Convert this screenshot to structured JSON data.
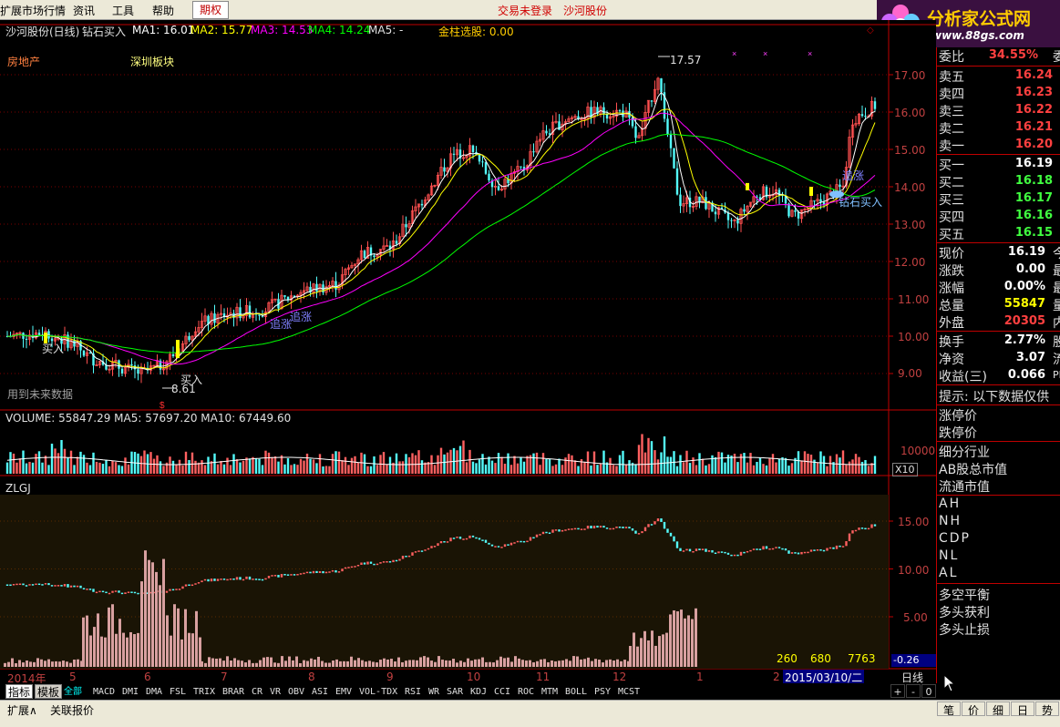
{
  "menu": {
    "items": [
      "扩展市场行情",
      "资讯",
      "工具",
      "帮助"
    ],
    "active_tab": "期权",
    "login_status": "交易未登录",
    "stock_name": "沙河股份"
  },
  "logo": {
    "title": "分析家公式网",
    "url": "www.88gs.com"
  },
  "main_header": {
    "title": "沙河股份(日线)",
    "indicator": "钻石买入",
    "ma1": "MA1: 16.01",
    "ma2": "MA2: 15.77",
    "ma3": "MA3: 14.53",
    "ma4": "MA4: 14.24",
    "ma5": "MA5: -",
    "gold_pick": "金柱选股: 0.00",
    "sector1": "房地产",
    "sector2": "深圳板块",
    "note": "用到未来数据",
    "high_label": "17.57",
    "low_label": "8.61",
    "annotations": [
      "追涨",
      "追涨",
      "买入",
      "钻石买入",
      "追涨",
      "买入"
    ],
    "colors": {
      "ma1": "#ffffff",
      "ma2": "#ffff00",
      "ma3": "#ff00ff",
      "ma4": "#00ff00",
      "up": "#ff5050",
      "down": "#54fcfc"
    }
  },
  "price_axis": [
    "17.00",
    "16.00",
    "15.00",
    "14.00",
    "13.00",
    "12.00",
    "11.00",
    "10.00",
    "9.00"
  ],
  "volume": {
    "header": "VOLUME: 55847.29  MA5: 57697.20  MA10: 67449.60",
    "axis_label": "10000",
    "unit": "X10"
  },
  "zlgj": {
    "title": "ZLGJ",
    "axis": [
      "15.00",
      "10.00",
      "5.00"
    ],
    "values": [
      "260",
      "680",
      "7763"
    ],
    "current": "-0.26"
  },
  "time_axis": {
    "labels": [
      "2014年",
      "5",
      "6",
      "7",
      "8",
      "9",
      "10",
      "11",
      "12",
      "1",
      "2"
    ],
    "cursor_date": "2015/03/10/二",
    "period": "日线"
  },
  "quote": {
    "wei_bi_label": "委比",
    "wei_bi": "34.55%",
    "wei_cha": "委",
    "asks": [
      {
        "label": "卖五",
        "price": "16.24"
      },
      {
        "label": "卖四",
        "price": "16.23"
      },
      {
        "label": "卖三",
        "price": "16.22"
      },
      {
        "label": "卖二",
        "price": "16.21"
      },
      {
        "label": "卖一",
        "price": "16.20"
      }
    ],
    "bids": [
      {
        "label": "买一",
        "price": "16.19"
      },
      {
        "label": "买二",
        "price": "16.18"
      },
      {
        "label": "买三",
        "price": "16.17"
      },
      {
        "label": "买四",
        "price": "16.16"
      },
      {
        "label": "买五",
        "price": "16.15"
      }
    ],
    "stats1": [
      {
        "label": "现价",
        "value": "16.19",
        "ext": "今"
      },
      {
        "label": "涨跌",
        "value": "0.00",
        "ext": "最"
      },
      {
        "label": "涨幅",
        "value": "0.00%",
        "ext": "最"
      },
      {
        "label": "总量",
        "value": "55847",
        "ext": "量"
      },
      {
        "label": "外盘",
        "value": "20305",
        "ext": "内"
      }
    ],
    "stats2": [
      {
        "label": "换手",
        "value": "2.77%",
        "ext": "股"
      },
      {
        "label": "净资",
        "value": "3.07",
        "ext": "流"
      },
      {
        "label": "收益(三)",
        "value": "0.066",
        "ext": "PE"
      }
    ],
    "hint": "提示: 以下数据仅供",
    "limit_up": "涨停价",
    "limit_down": "跌停价",
    "info": [
      "细分行业",
      "AB股总市值",
      "流通市值"
    ],
    "ah": [
      "AH",
      "NH",
      "CDP",
      "NL",
      "AL"
    ],
    "signals": [
      "多空平衡",
      "多头获利",
      "多头止损"
    ]
  },
  "tabs": {
    "side": [
      "指标",
      "模板"
    ],
    "items": [
      "全部",
      "MACD",
      "DMI",
      "DMA",
      "FSL",
      "TRIX",
      "BRAR",
      "CR",
      "VR",
      "OBV",
      "ASI",
      "EMV",
      "VOL-TDX",
      "RSI",
      "WR",
      "SAR",
      "KDJ",
      "CCI",
      "ROC",
      "MTM",
      "BOLL",
      "PSY",
      "MCST"
    ],
    "small": [
      "+",
      "-",
      "0"
    ]
  },
  "bottom": {
    "left": [
      "扩展∧",
      "关联报价"
    ],
    "right": [
      "笔",
      "价",
      "细",
      "日",
      "势"
    ]
  }
}
